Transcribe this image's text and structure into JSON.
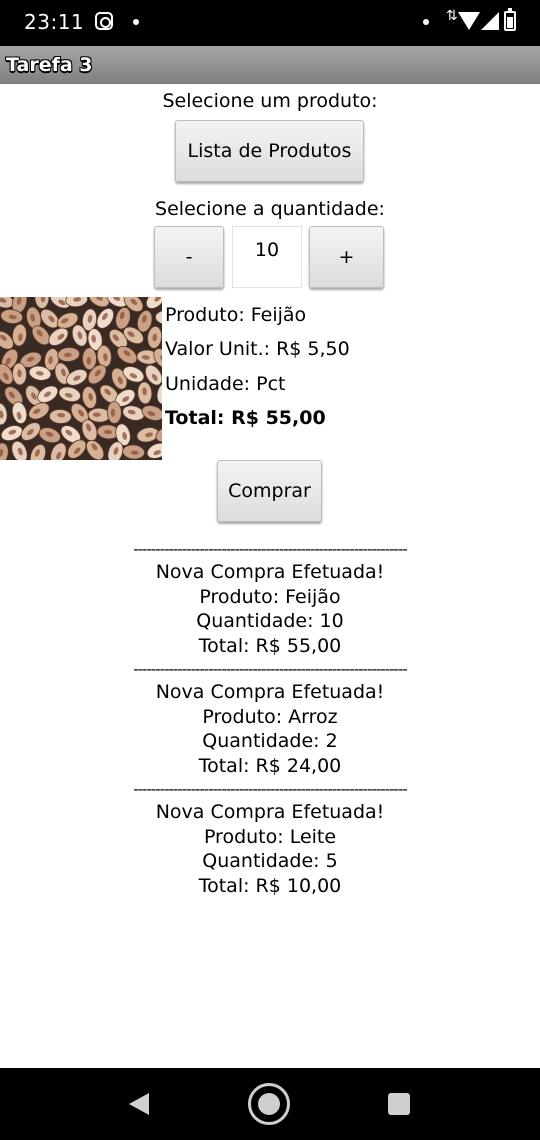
{
  "status_bar": {
    "time": "23:11",
    "data_indicator": "4"
  },
  "app": {
    "title": "Tarefa 3"
  },
  "product_select": {
    "label": "Selecione um produto:",
    "button_label": "Lista de Produtos"
  },
  "quantity": {
    "label": "Selecione a quantidade:",
    "minus_label": "-",
    "value": "10",
    "plus_label": "+"
  },
  "product_info": {
    "image_icon": "beans-photo",
    "name": "Produto: Feijão",
    "unit_price": "Valor Unit.: R$ 5,50",
    "unit": "Unidade: Pct",
    "total": "Total: R$ 55,00"
  },
  "buy_button": {
    "label": "Comprar"
  },
  "separator": "--------------------------------------------------------------",
  "purchases": [
    {
      "heading": "Nova Compra Efetuada!",
      "product": "Produto: Feijão",
      "quantity": "Quantidade: 10",
      "total": "Total: R$ 55,00"
    },
    {
      "heading": "Nova Compra Efetuada!",
      "product": "Produto: Arroz",
      "quantity": "Quantidade: 2",
      "total": "Total: R$ 24,00"
    },
    {
      "heading": "Nova Compra Efetuada!",
      "product": "Produto: Leite",
      "quantity": "Quantidade: 5",
      "total": "Total: R$ 10,00"
    }
  ],
  "colors": {
    "status_bar": "#000000",
    "title_bar": "#8f8f8f",
    "nav_bar": "#000000",
    "button": "#e6e6e6"
  }
}
